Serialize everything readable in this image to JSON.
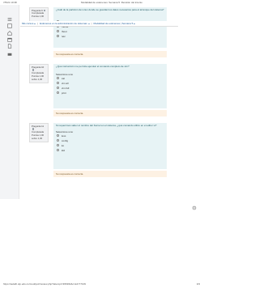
{
  "header": {
    "left": "7/5/21 19:38",
    "center": "Modalidad de exámenes: Semana 5: Revisión del intento"
  },
  "footer": {
    "url": "https://aulafit.utp.edu.co/mod/quiz/review.php?attempt=366394&cmid=77109",
    "page": "3/4"
  },
  "navbar": {
    "items": [
      "Mis cursos",
      "Exámenes en la administración de sistemas",
      "Modalidad de exámenes | Semana 5"
    ]
  },
  "questions": [
    {
      "info": [
        "Pregunta 9",
        "Completada",
        "Puntúa 1,00"
      ],
      "prompt": "¿Cuál de la partición de Linux donde se guardan los datos necesarios para el arranque del sistema?",
      "options": [
        "/swap",
        "/home",
        "/boot",
        "/etc"
      ],
      "feedback": "Su respuesta es correcta."
    },
    {
      "info": [
        "Pregunta 10",
        "Completada",
        "Puntúa 1,00 sobre 1,00"
      ],
      "prompt": "¿Qué instrucción me permite ejecutar el comando completo de vim?",
      "select_label": "Seleccione una:",
      "options": [
        "cat",
        "vim all",
        "vim full",
        "print"
      ],
      "feedback": "Su respuesta es correcta."
    },
    {
      "info": [
        "Pregunta 11",
        "Completada",
        "Puntúa 1,00 sobre 1,00"
      ],
      "prompt": "Si requerimos saber el nombre del Kernel en el sistema, ¿qué comando utilizo en el editor vi?",
      "select_label": "Seleccione una:",
      "options": [
        "less",
        "config",
        "ko",
        "ldd"
      ],
      "feedback": "Su respuesta es correcta."
    }
  ]
}
